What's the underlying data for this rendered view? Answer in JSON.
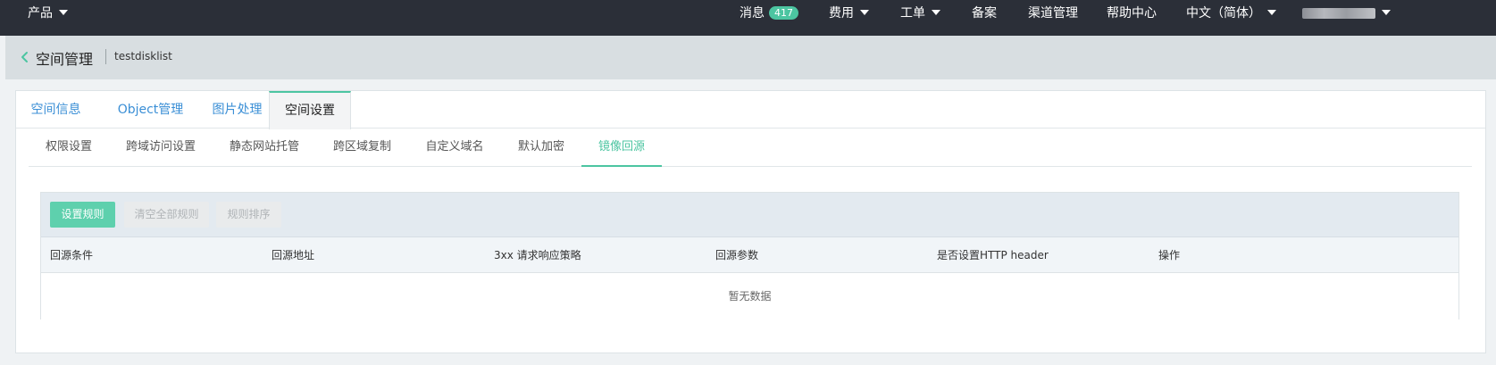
{
  "topbar": {
    "products_label": "产品",
    "messages_label": "消息",
    "messages_count": "417",
    "billing_label": "费用",
    "tickets_label": "工单",
    "filing_label": "备案",
    "channel_label": "渠道管理",
    "help_label": "帮助中心",
    "language_label": "中文（简体）"
  },
  "header": {
    "title": "空间管理",
    "bucket_name": "testdisklist"
  },
  "main_tabs": [
    {
      "label": "空间信息"
    },
    {
      "label": "Object管理"
    },
    {
      "label": "图片处理"
    },
    {
      "label": "空间设置"
    }
  ],
  "sub_tabs": [
    {
      "label": "权限设置"
    },
    {
      "label": "跨域访问设置"
    },
    {
      "label": "静态网站托管"
    },
    {
      "label": "跨区域复制"
    },
    {
      "label": "自定义域名"
    },
    {
      "label": "默认加密"
    },
    {
      "label": "镜像回源"
    }
  ],
  "toolbar": {
    "set_rule_label": "设置规则",
    "clear_rules_label": "清空全部规则",
    "sort_rules_label": "规则排序"
  },
  "table": {
    "columns": [
      "回源条件",
      "回源地址",
      "3xx 请求响应策略",
      "回源参数",
      "是否设置HTTP header",
      "操作"
    ],
    "empty_text": "暂无数据"
  },
  "colors": {
    "accent": "#4cc5a1",
    "topbar_bg": "#2b2f38",
    "link": "#3b8fd6"
  }
}
